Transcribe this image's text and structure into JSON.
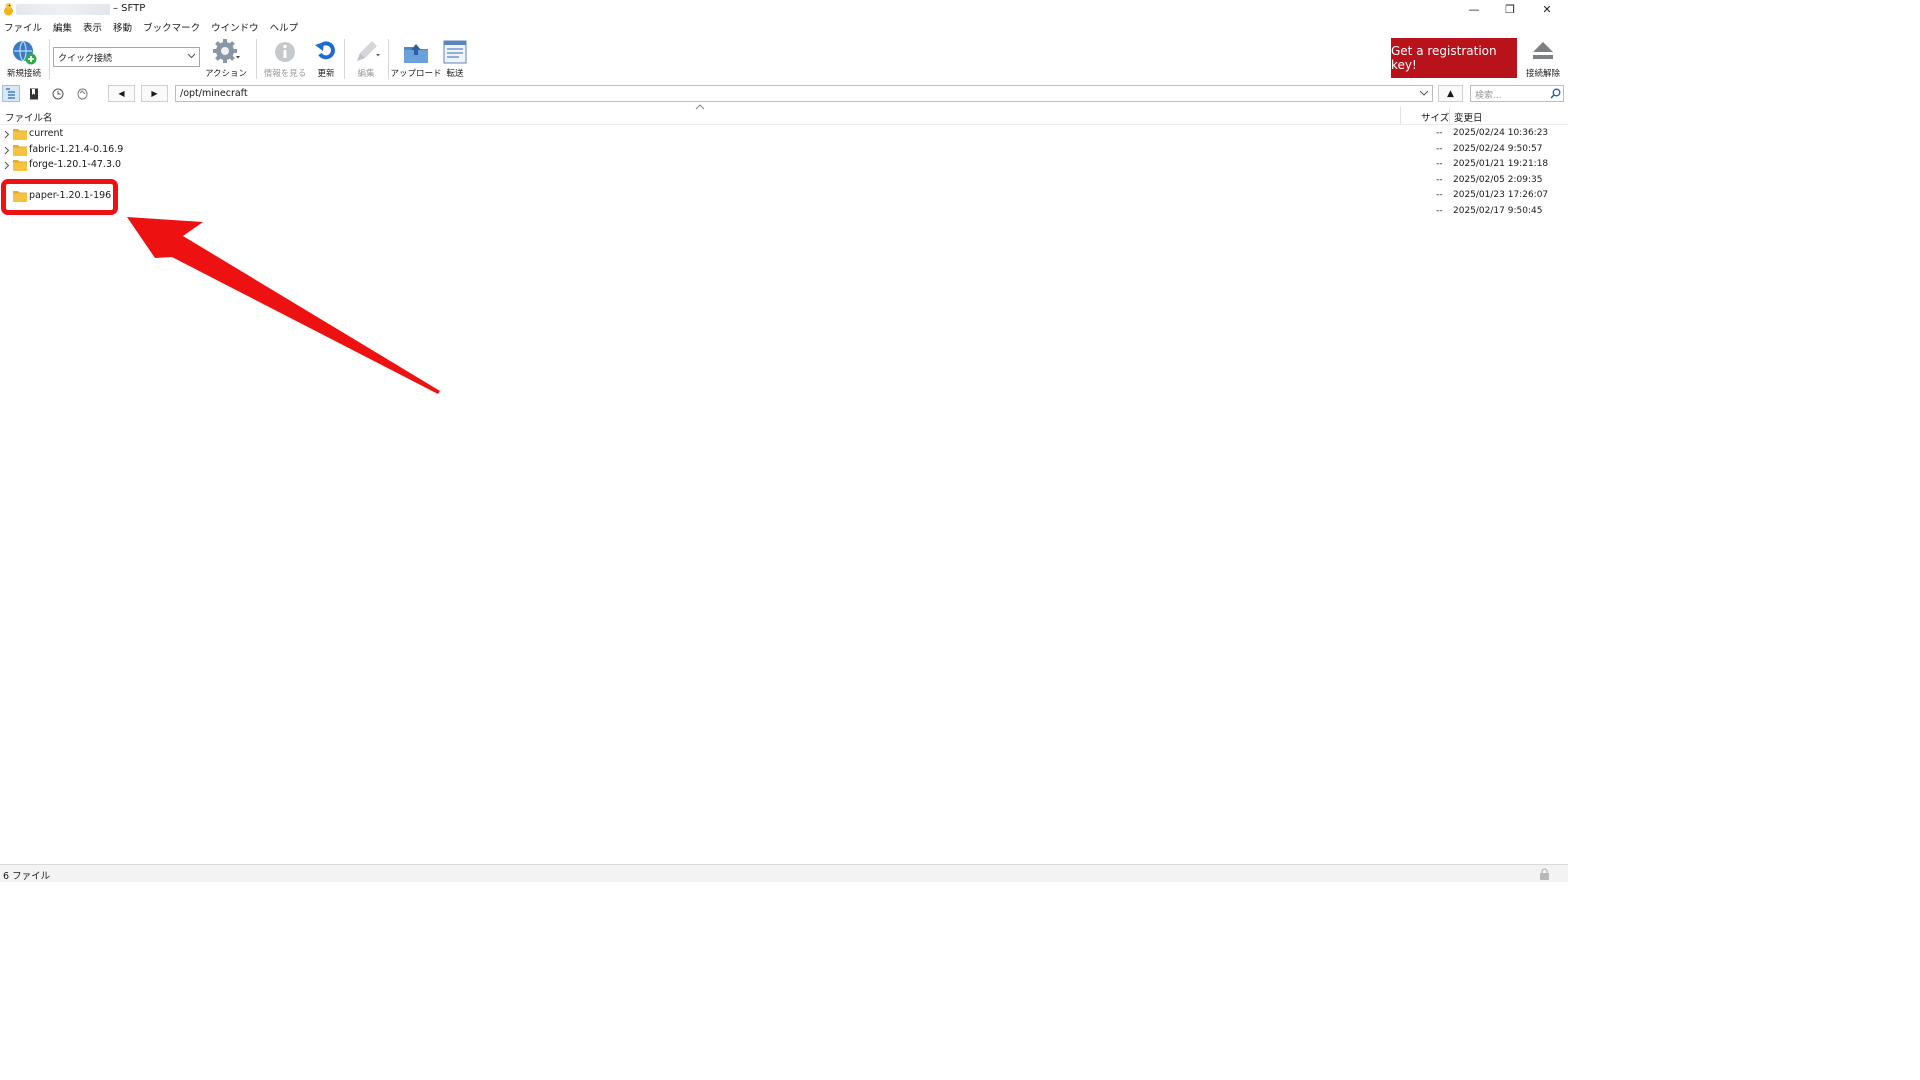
{
  "window": {
    "title_suffix": "– SFTP",
    "minimize_glyph": "—",
    "restore_glyph": "❐",
    "close_glyph": "✕"
  },
  "menu": [
    "ファイル",
    "編集",
    "表示",
    "移動",
    "ブックマーク",
    "ウインドウ",
    "ヘルプ"
  ],
  "toolbar": {
    "new_connection": "新規接続",
    "quick_connect_value": "クイック接続",
    "action": "アクション",
    "get_info": "情報を見る",
    "refresh": "更新",
    "edit": "編集",
    "upload": "アップロード",
    "transfer": "転送",
    "registration": "Get a registration key!",
    "disconnect": "接続解除"
  },
  "nav": {
    "back_glyph": "◀",
    "forward_glyph": "▶",
    "path": "/opt/minecraft",
    "up_glyph": "▲",
    "search_placeholder": "検索..."
  },
  "columns": {
    "filename": "ファイル名",
    "size": "サイズ",
    "modified": "変更日"
  },
  "files": [
    {
      "name": "current",
      "size": "--",
      "modified": "2025/02/24 10:36:23"
    },
    {
      "name": "fabric-1.21.4-0.16.9",
      "size": "--",
      "modified": "2025/02/24 9:50:57"
    },
    {
      "name": "forge-1.20.1-47.3.0",
      "size": "--",
      "modified": "2025/01/21 19:21:18"
    },
    {
      "name": "",
      "size": "--",
      "modified": "2025/02/05 2:09:35"
    },
    {
      "name": "paper-1.20.1-196",
      "size": "--",
      "modified": "2025/01/23 17:26:07"
    },
    {
      "name": "",
      "size": "--",
      "modified": "2025/02/17 9:50:45"
    }
  ],
  "status": {
    "count_text": "6 ファイル"
  },
  "colors": {
    "accent_red": "#b8121a",
    "annotation_red": "#ee1111",
    "folder_yellow": "#f5c342"
  },
  "icons": [
    "app-icon",
    "new-connection-icon",
    "gear-icon",
    "info-icon",
    "refresh-icon",
    "edit-pencil-icon",
    "upload-folder-icon",
    "transfer-queue-icon",
    "eject-icon",
    "browser-view-icon",
    "bookmark-icon",
    "history-icon",
    "bonjour-icon",
    "folder-icon",
    "chevron-right-icon",
    "search-icon",
    "lock-icon"
  ]
}
